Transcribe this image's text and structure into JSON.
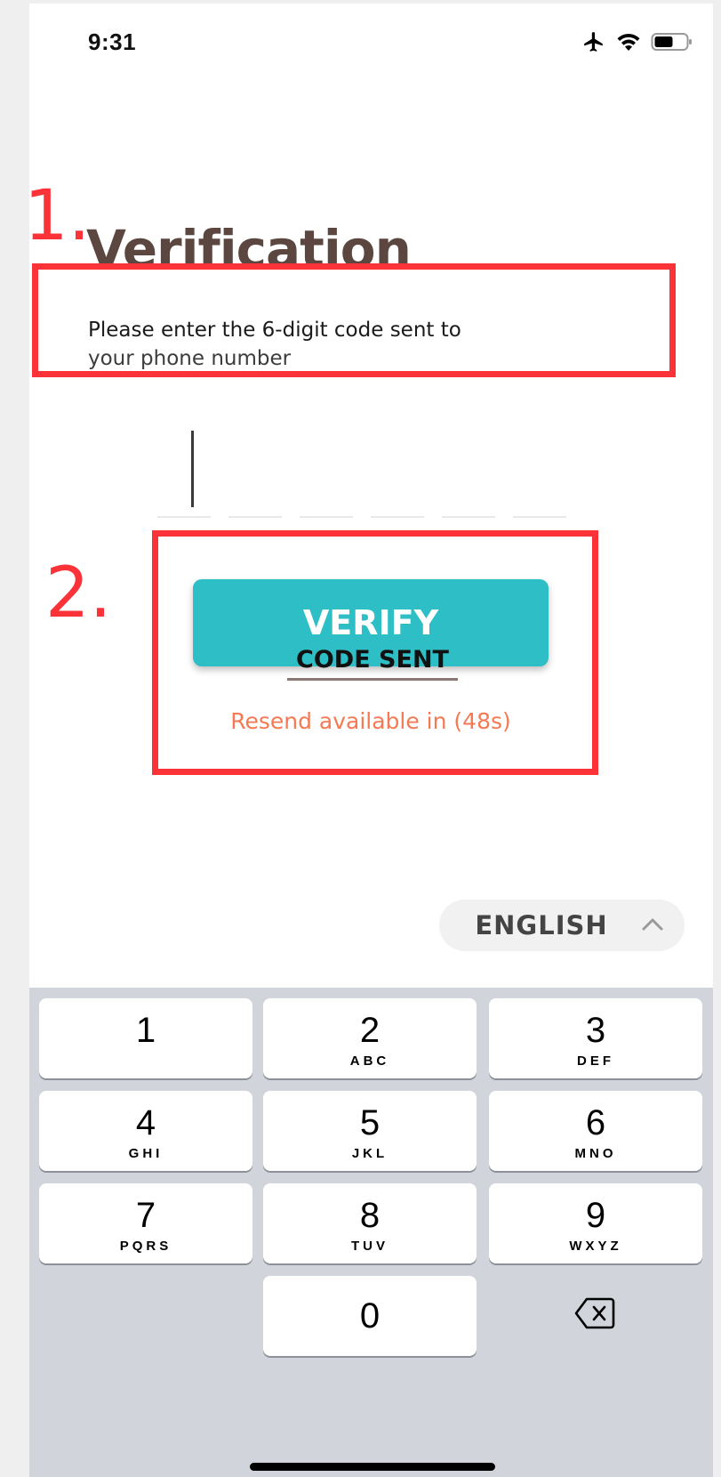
{
  "status_bar": {
    "time": "9:31"
  },
  "annotations": {
    "first": "1.",
    "second": "2."
  },
  "verification": {
    "title": "Verification",
    "subtitle_line1": "Please enter the 6-digit code sent to",
    "subtitle_line2": "your phone number",
    "otp_digits": [
      "",
      "",
      "",
      "",
      "",
      ""
    ],
    "verify_label": "VERIFY",
    "code_sent_label": "CODE SENT",
    "resend_text": "Resend available in (48s)"
  },
  "language": {
    "label": "ENGLISH",
    "icon": "chevron-up-icon"
  },
  "keypad": {
    "rows": [
      [
        {
          "digit": "1",
          "letters": ""
        },
        {
          "digit": "2",
          "letters": "ABC"
        },
        {
          "digit": "3",
          "letters": "DEF"
        }
      ],
      [
        {
          "digit": "4",
          "letters": "GHI"
        },
        {
          "digit": "5",
          "letters": "JKL"
        },
        {
          "digit": "6",
          "letters": "MNO"
        }
      ],
      [
        {
          "digit": "7",
          "letters": "PQRS"
        },
        {
          "digit": "8",
          "letters": "TUV"
        },
        {
          "digit": "9",
          "letters": "WXYZ"
        }
      ]
    ],
    "zero": "0",
    "delete_icon": "backspace-icon"
  },
  "colors": {
    "accent": "#2ebfc6",
    "annotation": "#fb3338",
    "resend": "#f47a53",
    "title": "#5b4640"
  }
}
